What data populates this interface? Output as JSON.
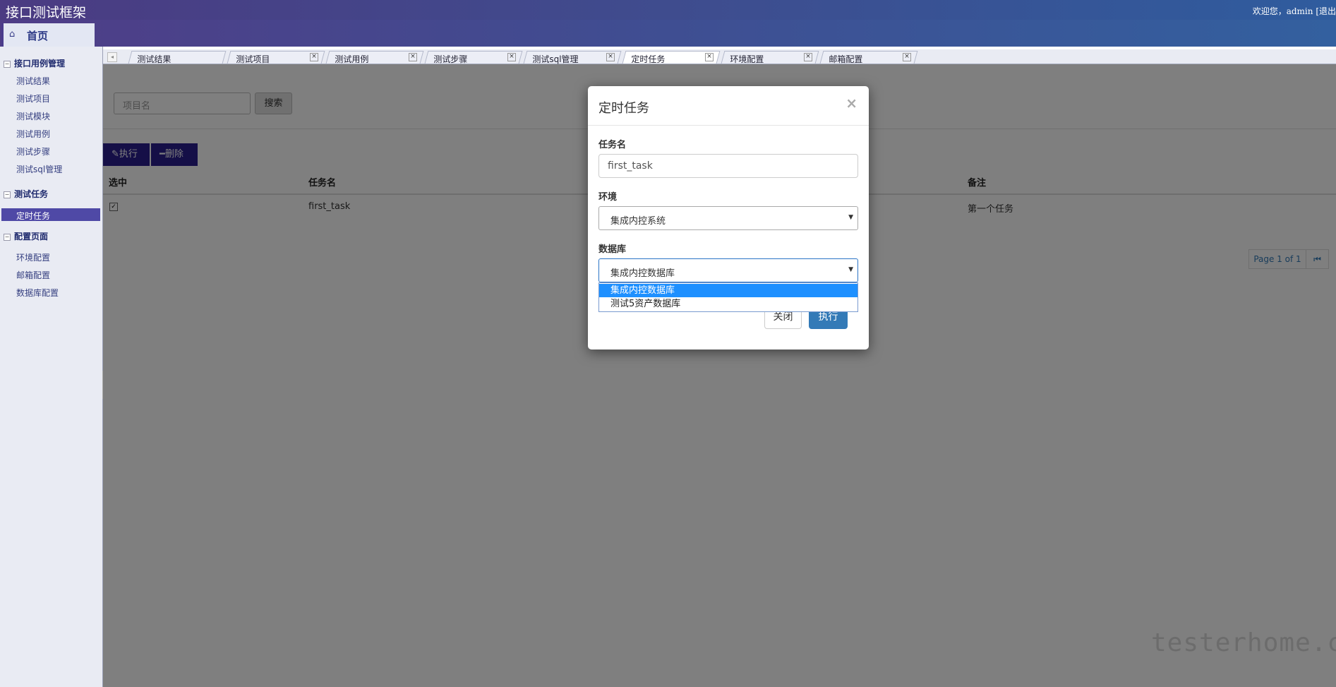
{
  "header": {
    "app_title": "接口测试框架",
    "welcome_text": "欢迎您，admin [退出"
  },
  "home_tab": {
    "label": "首页",
    "icon": "home-icon"
  },
  "sidebar": {
    "groups": [
      {
        "label": "接口用例管理",
        "items": [
          "测试结果",
          "测试项目",
          "测试模块",
          "测试用例",
          "测试步骤",
          "测试sql管理"
        ]
      },
      {
        "label": "测试任务",
        "items": [
          "定时任务"
        ]
      },
      {
        "label": "配置页面",
        "items": [
          "环境配置",
          "邮箱配置",
          "数据库配置"
        ]
      }
    ],
    "active_item": "定时任务"
  },
  "tabs": [
    {
      "label": "测试结果"
    },
    {
      "label": "测试项目"
    },
    {
      "label": "测试用例"
    },
    {
      "label": "测试步骤"
    },
    {
      "label": "测试sql管理"
    },
    {
      "label": "定时任务"
    },
    {
      "label": "环境配置"
    },
    {
      "label": "邮箱配置"
    }
  ],
  "search": {
    "placeholder": "项目名",
    "button_label": "搜索"
  },
  "actions": {
    "run_label": "执行",
    "delete_label": "删除"
  },
  "table": {
    "headers": {
      "select": "选中",
      "task_name": "任务名",
      "note": "备注"
    },
    "rows": [
      {
        "checked": true,
        "task_name": "first_task",
        "note": "第一个任务"
      }
    ]
  },
  "pagination": {
    "page_text": "Page 1 of 1"
  },
  "modal": {
    "title": "定时任务",
    "task_label": "任务名",
    "task_value": "first_task",
    "env_label": "环境",
    "env_value": "集成内控系统",
    "db_label": "数据库",
    "db_value": "集成内控数据库",
    "db_options": [
      "集成内控数据库",
      "测试5资产数据库"
    ],
    "close_label": "关闭",
    "run_label": "执行"
  },
  "watermark": "testerhome.com",
  "colors": {
    "header_start": "#4b3b82",
    "header_end": "#2f5c9e",
    "accent": "#2a1e8e",
    "primary": "#337ab7",
    "dropdown_highlight": "#1e90ff"
  }
}
